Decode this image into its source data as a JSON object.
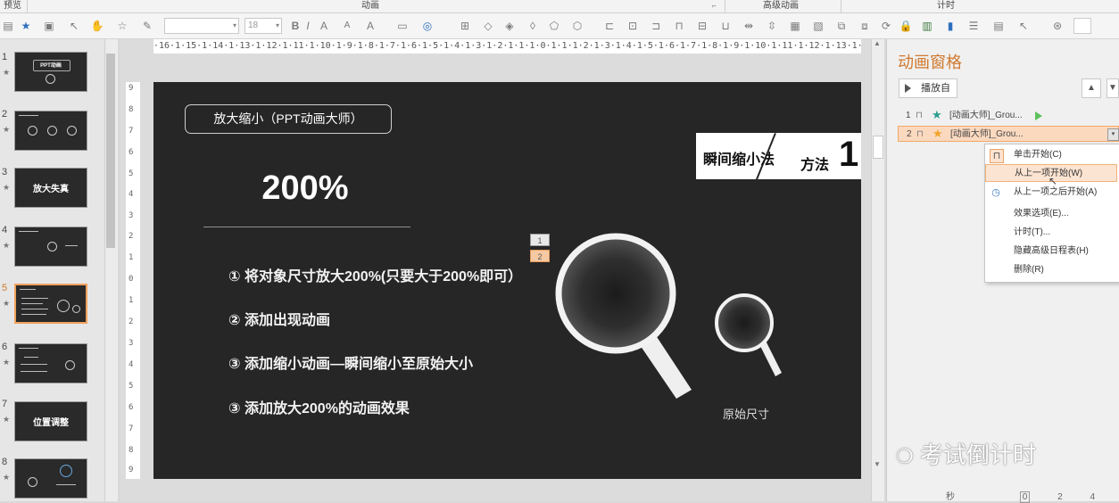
{
  "ribbon": {
    "groups": [
      "预览",
      "动画",
      "高级动画",
      "计时"
    ],
    "launcher_icon": "dialog-launcher-icon"
  },
  "toolbar": {
    "font_value": "",
    "size_value": "18",
    "bold": "B",
    "italic": "I",
    "grow_font": "A",
    "shrink_font": "A",
    "font_color": "A"
  },
  "thumbnails": [
    {
      "num": "1",
      "caption": "PPT动画"
    },
    {
      "num": "2",
      "caption": ""
    },
    {
      "num": "3",
      "caption": "放大失真"
    },
    {
      "num": "4",
      "caption": ""
    },
    {
      "num": "5",
      "caption": ""
    },
    {
      "num": "6",
      "caption": ""
    },
    {
      "num": "7",
      "caption": "位置调整"
    },
    {
      "num": "8",
      "caption": ""
    }
  ],
  "ruler": {
    "horizontal": "·16·1·15·1·14·1·13·1·12·1·11·1·10·1·9·1·8·1·7·1·6·1·5·1·4·1·3·1·2·1·1·1·0·1·1·1·2·1·3·1·4·1·5·1·6·1·7·1·8·1·9·1·10·1·11·1·12·1·13·1·14·1·15·1·16·",
    "vertical": [
      "9",
      "8",
      "7",
      "6",
      "5",
      "4",
      "3",
      "2",
      "1",
      "0",
      "1",
      "2",
      "3",
      "4",
      "5",
      "6",
      "7",
      "8",
      "9"
    ]
  },
  "slide": {
    "title_box": "放大缩小（PPT动画大师）",
    "big_percent": "200%",
    "bullets": [
      "① 将对象尺寸放大200%(只要大于200%即可）",
      "② 添加出现动画",
      "③ 添加缩小动画—瞬间缩小至原始大小",
      "③ 添加放大200%的动画效果"
    ],
    "tag_left": "瞬间缩小法",
    "tag_right": "方法",
    "tag_number": "1",
    "anim_badges": [
      "1",
      "2"
    ],
    "original_size_label": "原始尺寸"
  },
  "anim_pane": {
    "title": "动画窗格",
    "play_button": "播放自",
    "up_arrow": "▲",
    "down_arrow": "▼",
    "items": [
      {
        "num": "1",
        "name": "[动画大师]_Grou..."
      },
      {
        "num": "2",
        "name": "[动画大师]_Grou..."
      }
    ],
    "context_menu": [
      "单击开始(C)",
      "从上一项开始(W)",
      "从上一项之后开始(A)",
      "效果选项(E)...",
      "计时(T)...",
      "隐藏高级日程表(H)",
      "删除(R)"
    ],
    "timeline_label": "秒",
    "timeline_ticks": [
      "0",
      "2",
      "4"
    ]
  },
  "watermark": "考试倒计时",
  "colors": {
    "accent_orange": "#d0782e",
    "slide_bg": "#262626",
    "selection_bg": "#fbd9bf"
  }
}
